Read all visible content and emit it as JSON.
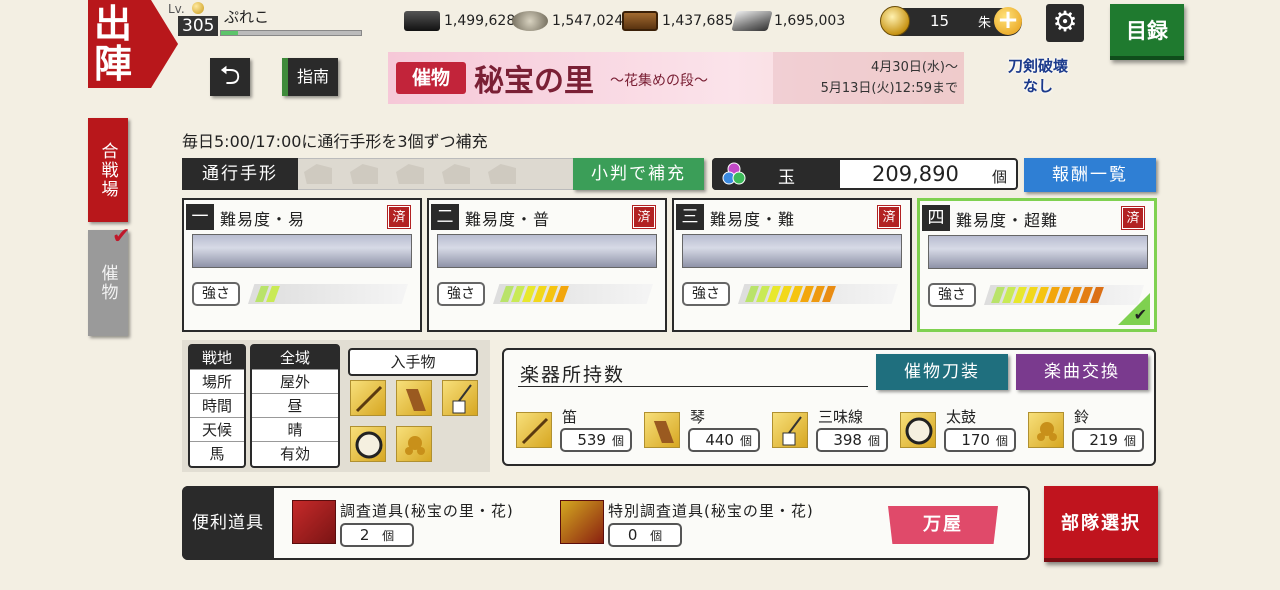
{
  "header": {
    "sortie_title": "出\n陣",
    "level_label": "Lv.",
    "level": "305",
    "player_name": "ぷれこ",
    "exp_ratio": 0.12,
    "resources": [
      {
        "name": "charcoal",
        "icon": "charcoal-icon",
        "value": "1,499,628"
      },
      {
        "name": "jewel-steel",
        "icon": "steel-icon",
        "value": "1,547,024"
      },
      {
        "name": "cooling-material",
        "icon": "water-box-icon",
        "value": "1,437,685"
      },
      {
        "name": "whetstone",
        "icon": "whetstone-icon",
        "value": "1,695,003"
      }
    ],
    "koban": "15",
    "koban_unit": "朱",
    "plus_glyph": "+",
    "gear_glyph": "⚙",
    "catalog_label": "目録"
  },
  "toolbar": {
    "back_glyph": "⮌",
    "guide_label": "指南"
  },
  "banner": {
    "tag": "催物",
    "title": "秘宝の里",
    "subtitle": "〜花集めの段〜",
    "period_start": "4月30日(水)〜",
    "period_end": "5月13日(火)12:59まで"
  },
  "break_notice": {
    "line1": "刀剣破壊",
    "line2": "なし"
  },
  "side_tabs": {
    "battle_field": "合戦場",
    "event": "催物",
    "check_glyph": "✔"
  },
  "notice": "毎日5:00/17:00に通行手形を3個ずつ補充",
  "pass": {
    "label": "通行手形",
    "slots": 5,
    "refill_label": "小判で補充"
  },
  "tama": {
    "label": "玉",
    "value": "209,890",
    "unit": "個"
  },
  "reward_list_label": "報酬一覧",
  "difficulties": [
    {
      "num": "一",
      "title": "難易度・易",
      "done": "済",
      "strength_label": "強さ",
      "strength": 2,
      "selected": false
    },
    {
      "num": "二",
      "title": "難易度・普",
      "done": "済",
      "strength_label": "強さ",
      "strength": 6,
      "selected": false
    },
    {
      "num": "三",
      "title": "難易度・難",
      "done": "済",
      "strength_label": "強さ",
      "strength": 8,
      "selected": false
    },
    {
      "num": "四",
      "title": "難易度・超難",
      "done": "済",
      "strength_label": "強さ",
      "strength": 10,
      "selected": true,
      "check_glyph": "✔"
    }
  ],
  "field_info": {
    "labels": [
      "戦地",
      "場所",
      "時間",
      "天候",
      "馬"
    ],
    "values": [
      "全域",
      "屋外",
      "昼",
      "晴",
      "有効"
    ]
  },
  "obtainables": {
    "title": "入手物",
    "items": [
      "flute-icon",
      "koto-icon",
      "shamisen-icon",
      "taiko-icon",
      "suzu-icon"
    ]
  },
  "instruments": {
    "title": "楽器所持数",
    "event_sword_button": "催物刀装",
    "music_exchange_button": "楽曲交換",
    "unit": "個",
    "items": [
      {
        "name": "笛",
        "count": "539",
        "icon": "flute-icon"
      },
      {
        "name": "琴",
        "count": "440",
        "icon": "koto-icon"
      },
      {
        "name": "三味線",
        "count": "398",
        "icon": "shamisen-icon"
      },
      {
        "name": "太鼓",
        "count": "170",
        "icon": "taiko-icon"
      },
      {
        "name": "鈴",
        "count": "219",
        "icon": "suzu-icon"
      }
    ]
  },
  "tools": {
    "label": "便利道具",
    "unit": "個",
    "items": [
      {
        "name": "調査道具(秘宝の里・花)",
        "count": "2",
        "icon": "gift-box-icon"
      },
      {
        "name": "特別調査道具(秘宝の里・花)",
        "count": "0",
        "icon": "gift-box-special-icon"
      }
    ],
    "shop_label": "万屋"
  },
  "squad_select_label": "部隊選択",
  "colors": {
    "primary_red": "#b8171b",
    "green": "#1f7a2f",
    "teal": "#1f6f7e",
    "purple": "#7a3a8e",
    "blue": "#2f7fd4",
    "selected_border": "#7fd150"
  }
}
